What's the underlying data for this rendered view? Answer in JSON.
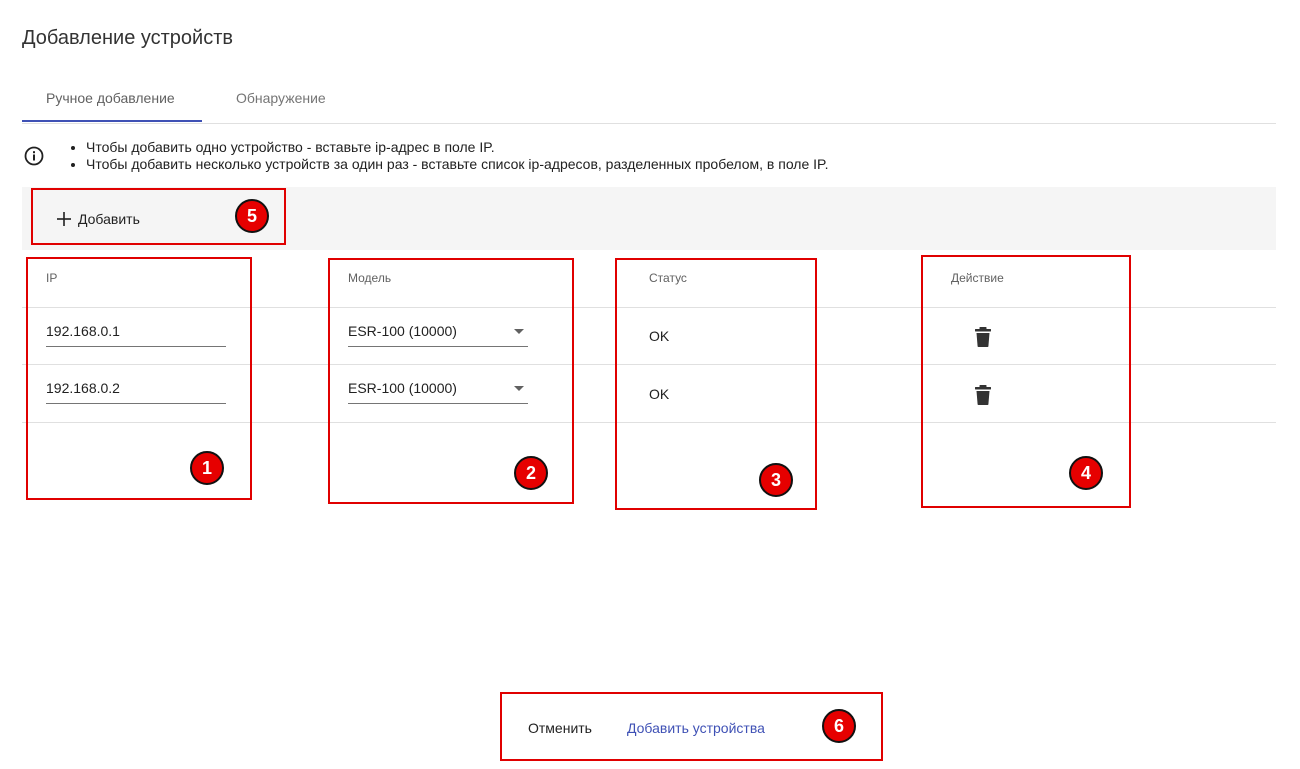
{
  "dialog": {
    "title": "Добавление устройств"
  },
  "tabs": [
    {
      "label": "Ручное добавление",
      "active": true
    },
    {
      "label": "Обнаружение",
      "active": false
    }
  ],
  "info": {
    "icon": "info-circle-icon",
    "hints": [
      "Чтобы добавить одно устройство - вставьте ip-адрес в поле IP.",
      "Чтобы добавить несколько устройств за один раз - вставьте список ip-адресов, разделенных пробелом, в поле IP."
    ]
  },
  "toolbar": {
    "add_label": "Добавить",
    "add_icon": "plus-icon"
  },
  "table": {
    "columns": [
      "IP",
      "Модель",
      "Статус",
      "Действие"
    ],
    "rows": [
      {
        "ip": "192.168.0.1",
        "model": "ESR-100 (10000)",
        "status": "OK",
        "action_icon": "trash-icon"
      },
      {
        "ip": "192.168.0.2",
        "model": "ESR-100 (10000)",
        "status": "OK",
        "action_icon": "trash-icon"
      }
    ]
  },
  "footer": {
    "cancel_label": "Отменить",
    "submit_label": "Добавить устройства"
  },
  "annotations": [
    "1",
    "2",
    "3",
    "4",
    "5",
    "6"
  ],
  "colors": {
    "accent": "#3f51b5",
    "annotation": "#e00000",
    "toolbar_bg": "#f5f5f5",
    "divider": "#e0e0e0"
  }
}
